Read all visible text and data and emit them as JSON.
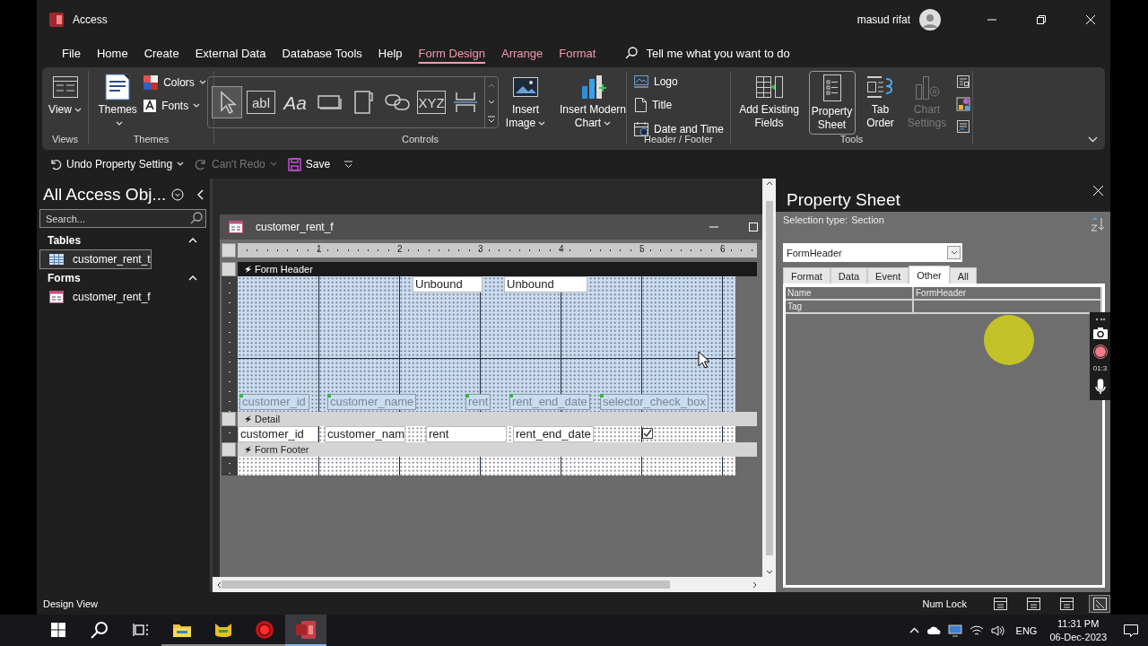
{
  "window": {
    "app_title": "Access",
    "user": "masud rifat"
  },
  "menu": [
    {
      "label": "File",
      "selected": false,
      "contextual": false
    },
    {
      "label": "Home",
      "selected": false,
      "contextual": false
    },
    {
      "label": "Create",
      "selected": false,
      "contextual": false
    },
    {
      "label": "External Data",
      "selected": false,
      "contextual": false
    },
    {
      "label": "Database Tools",
      "selected": false,
      "contextual": false
    },
    {
      "label": "Help",
      "selected": false,
      "contextual": false
    },
    {
      "label": "Form Design",
      "selected": true,
      "contextual": true
    },
    {
      "label": "Arrange",
      "selected": false,
      "contextual": true
    },
    {
      "label": "Format",
      "selected": false,
      "contextual": true
    }
  ],
  "tell_me": {
    "placeholder": "Tell me what you want to do"
  },
  "ribbon": {
    "groups": [
      {
        "title": "Views",
        "items": [
          {
            "kind": "large",
            "label": "View",
            "has_menu": true
          }
        ]
      },
      {
        "title": "Themes",
        "items": [
          {
            "kind": "large",
            "label": "Themes",
            "has_menu": true
          },
          {
            "kind": "small",
            "label": "Colors",
            "has_menu": true
          },
          {
            "kind": "small",
            "label": "Fonts",
            "has_menu": true
          }
        ]
      },
      {
        "title": "Controls",
        "items": [
          {
            "kind": "gallery",
            "tools": [
              {
                "selected": true
              },
              {
                "selected": false,
                "glyph": "abl"
              },
              {
                "selected": false,
                "glyph": "Aa"
              },
              {
                "selected": false
              },
              {
                "selected": false
              },
              {
                "selected": false
              },
              {
                "selected": false,
                "glyph": "XYZ"
              },
              {
                "selected": false
              }
            ]
          },
          {
            "kind": "large",
            "label": "Insert Image",
            "has_menu": true
          },
          {
            "kind": "large",
            "label": "Insert Modern Chart",
            "has_menu": true
          }
        ]
      },
      {
        "title": "Header / Footer",
        "items": [
          {
            "kind": "small",
            "label": "Logo"
          },
          {
            "kind": "small",
            "label": "Title"
          },
          {
            "kind": "small",
            "label": "Date and Time"
          }
        ]
      },
      {
        "title": "Tools",
        "items": [
          {
            "kind": "large",
            "label": "Add Existing Fields",
            "selected": false,
            "disabled": false
          },
          {
            "kind": "large",
            "label": "Property Sheet",
            "selected": true,
            "disabled": false
          },
          {
            "kind": "large",
            "label": "Tab Order",
            "selected": false,
            "disabled": false
          },
          {
            "kind": "large",
            "label": "Chart Settings",
            "selected": false,
            "disabled": true
          },
          {
            "kind": "icons"
          }
        ]
      }
    ]
  },
  "quick_access": [
    {
      "label": "Undo Property Setting",
      "disabled": false
    },
    {
      "label": "Can't Redo",
      "disabled": true
    },
    {
      "label": "Save",
      "disabled": false
    }
  ],
  "nav_pane": {
    "title": "All Access Obj...",
    "search": {
      "placeholder": "Search..."
    },
    "groups": [
      {
        "title": "Tables",
        "items": [
          {
            "label": "customer_rent_t",
            "selected": true
          }
        ]
      },
      {
        "title": "Forms",
        "items": [
          {
            "label": "customer_rent_f",
            "selected": false
          }
        ]
      }
    ]
  },
  "form_window": {
    "title": "customer_rent_f",
    "ruler": [
      "1",
      "2",
      "3",
      "4",
      "5",
      "6"
    ],
    "sections": [
      {
        "title": "Form Header",
        "selected": true,
        "controls": [
          {
            "kind": "textbox",
            "text": "Unbound"
          },
          {
            "kind": "textbox",
            "text": "Unbound"
          },
          {
            "kind": "label",
            "text": "customer_id"
          },
          {
            "kind": "label",
            "text": "customer_name"
          },
          {
            "kind": "label",
            "text": "rent"
          },
          {
            "kind": "label",
            "text": "rent_end_date"
          },
          {
            "kind": "label",
            "text": "selector_check_box"
          }
        ]
      },
      {
        "title": "Detail",
        "selected": false,
        "controls": [
          {
            "kind": "textbox",
            "text": "customer_id"
          },
          {
            "kind": "textbox",
            "text": "customer_nam"
          },
          {
            "kind": "textbox",
            "text": "rent"
          },
          {
            "kind": "textbox",
            "text": "rent_end_date"
          },
          {
            "kind": "checkbox",
            "checked": true
          }
        ]
      },
      {
        "title": "Form Footer",
        "selected": false
      }
    ]
  },
  "property_sheet": {
    "title": "Property Sheet",
    "selection_label": "Selection type:",
    "selection_type": "Section",
    "object": "FormHeader",
    "tabs": [
      {
        "label": "Format",
        "selected": false
      },
      {
        "label": "Data",
        "selected": false
      },
      {
        "label": "Event",
        "selected": false
      },
      {
        "label": "Other",
        "selected": true
      },
      {
        "label": "All",
        "selected": false
      }
    ],
    "rows": [
      {
        "name": "Name",
        "value": "FormHeader"
      },
      {
        "name": "Tag"
      }
    ]
  },
  "recorder": {
    "time": "01:3"
  },
  "status_bar": {
    "mode": "Design View",
    "indicator": "Num Lock",
    "views": [
      {
        "selected": false
      },
      {
        "selected": false
      },
      {
        "selected": false
      },
      {
        "selected": true
      }
    ]
  },
  "taskbar": {
    "apps": [
      {
        "running": true,
        "selected": false
      },
      {
        "running": true,
        "selected": false
      },
      {
        "running": true,
        "selected": false
      },
      {
        "running": true,
        "selected": true
      }
    ],
    "language": "ENG",
    "time": "11:31 PM",
    "date": "06-Dec-2023"
  }
}
